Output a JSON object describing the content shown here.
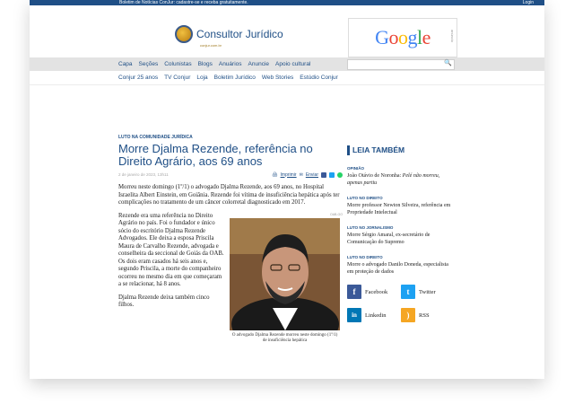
{
  "topbar": {
    "message": "Boletim de Notícias ConJur: cadastre-se e receba gratuitamente.",
    "login": "Login"
  },
  "logo": {
    "name": "Consultor Jurídico",
    "sub": "conjur.com.br"
  },
  "ad": {
    "word": "Google",
    "tag": "anúncio"
  },
  "nav_primary": [
    "Capa",
    "Seções",
    "Colunistas",
    "Blogs",
    "Anuários",
    "Anuncie",
    "Apoio cultural"
  ],
  "nav_secondary": [
    "Conjur 25 anos",
    "TV Conjur",
    "Loja",
    "Boletim Jurídico",
    "Web Stories",
    "Estúdio Conjur"
  ],
  "article": {
    "kicker": "LUTO NA COMUNIDADE JURÍDICA",
    "title": "Morre Djalma Rezende, referência no Direito Agrário, aos 69 anos",
    "date": "2 de janeiro de 2023, 13h11",
    "print": "Imprimir",
    "send": "Enviar",
    "lead": "Morreu neste domingo (1º/1) o advogado Djalma Rezende, aos 69 anos, no Hospital Israelita Albert Einstein, em Goiânia. Rezende foi vítima de insuficiência hepática após ter complicações no tratamento de um câncer colorretal diagnosticado em 2017.",
    "body": "Rezende era uma referência no Direito Agrário no país. Foi o fundador e único sócio do escritório Djalma Rezende Advogados. Ele deixa a esposa Priscila Maura de Carvalho Rezende, advogada e conselheira da seccional de Goiás da OAB. Os dois eram casados há seis anos e, segundo Priscila, a morte do companheiro ocorreu no mesmo dia em que começaram a se relacionar, há 8 anos.",
    "closing": "Djalma Rezende deixa também cinco filhos.",
    "photo_credit": "OAB-GO",
    "caption": "O advogado Djalma Rezende morreu neste domingo (1º/1) de insuficiência hepática"
  },
  "sidebar": {
    "title": "LEIA TAMBÉM",
    "items": [
      {
        "category": "OPINIÃO",
        "text": "João Otávio de Noronha: ",
        "italic": "Pelé não morreu, apenas partiu"
      },
      {
        "category": "LUTO NO DIREITO",
        "text": "Morre professor Newton Silveira, referência em Propriedade Intelectual",
        "italic": ""
      },
      {
        "category": "LUTO NO JORNALISMO",
        "text": "Morre Sérgio Amaral, ex-secretário de Comunicação do Supremo",
        "italic": ""
      },
      {
        "category": "LUTO NO DIREITO",
        "text": "Morre o advogado Danilo Doneda, especialista em proteção de dados",
        "italic": ""
      }
    ],
    "social": [
      {
        "label": "Facebook",
        "icon": "facebook-icon",
        "color": "#3b5998",
        "glyph": "f"
      },
      {
        "label": "Twitter",
        "icon": "twitter-icon",
        "color": "#1da1f2",
        "glyph": "t"
      },
      {
        "label": "Linkedin",
        "icon": "linkedin-icon",
        "color": "#0077b5",
        "glyph": "in"
      },
      {
        "label": "RSS",
        "icon": "rss-icon",
        "color": "#f5a623",
        "glyph": ")"
      }
    ]
  },
  "colors": {
    "brand": "#1f4f86",
    "nav_bg": "#e3e3e3"
  }
}
